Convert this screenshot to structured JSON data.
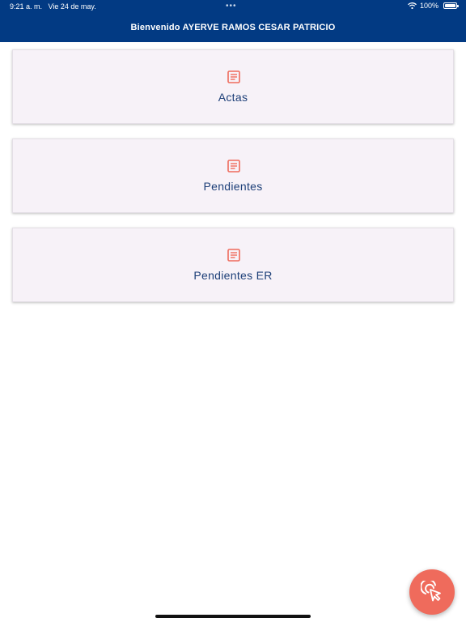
{
  "status_bar": {
    "time": "9:21 a. m.",
    "date": "Vie 24 de may.",
    "dots": "•••",
    "battery": "100%"
  },
  "header": {
    "title": "Bienvenido AYERVE RAMOS CESAR PATRICIO",
    "background": "#023a83"
  },
  "menu": {
    "items": [
      {
        "label": "Actas",
        "icon": "document-lines-icon"
      },
      {
        "label": "Pendientes",
        "icon": "document-lines-icon"
      },
      {
        "label": "Pendientes ER",
        "icon": "document-lines-icon"
      }
    ]
  },
  "fab": {
    "icon": "tap-cursor-icon",
    "color": "#ef6b5c"
  },
  "colors": {
    "accent": "#ef6b5c",
    "card_background": "#f7f2f8",
    "label_text": "#1d3f78"
  }
}
